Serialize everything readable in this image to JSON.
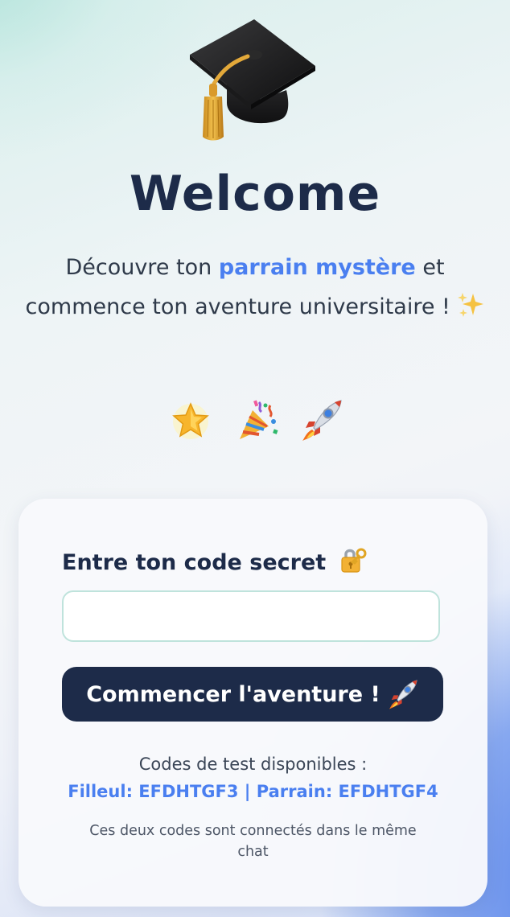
{
  "hero": {
    "title": "Welcome",
    "subtitle_part1": "Découvre ton ",
    "subtitle_accent": "parrain mystère",
    "subtitle_part2": " et commence ton aventure universitaire ! ",
    "subtitle_icon": "sparkles-icon",
    "header_icon": "graduation-cap-icon",
    "emoji_row": [
      "star-icon",
      "party-popper-icon",
      "rocket-icon"
    ]
  },
  "form": {
    "label": "Entre ton code secret",
    "label_icon": "locked-with-key-icon",
    "input_value": "",
    "submit_label": "Commencer l'aventure !",
    "submit_icon": "rocket-icon"
  },
  "test_info": {
    "title": "Codes de test disponibles :",
    "codes": "Filleul: EFDHTGF3 | Parrain: EFDHTGF4",
    "note": "Ces deux codes sont connectés dans le même chat"
  },
  "colors": {
    "primary_dark": "#1d2b49",
    "accent_blue": "#4a7ff0",
    "input_border": "#bfe3dc"
  }
}
